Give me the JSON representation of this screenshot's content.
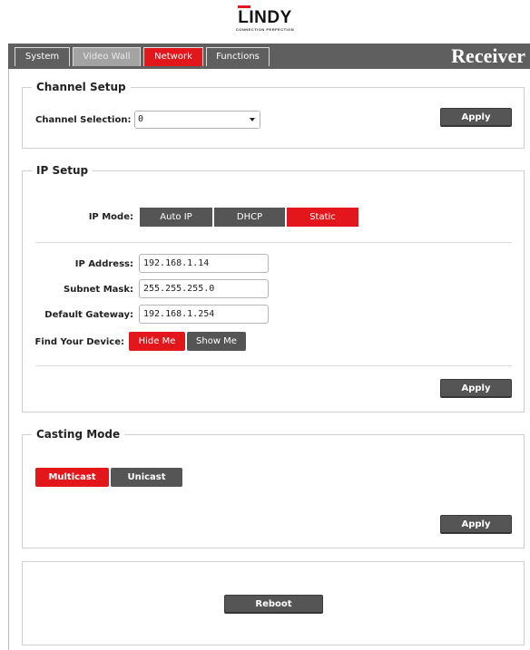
{
  "logo": {
    "brand": "LINDY",
    "tagline": "CONNECTION PERFECTION"
  },
  "tabs": [
    {
      "label": "System"
    },
    {
      "label": "Video Wall"
    },
    {
      "label": "Network"
    },
    {
      "label": "Functions"
    }
  ],
  "page_title": "Receiver",
  "channel_setup": {
    "legend": "Channel Setup",
    "channel_label": "Channel Selection:",
    "channel_value": "0",
    "apply_label": "Apply"
  },
  "ip_setup": {
    "legend": "IP Setup",
    "mode_label": "IP Mode:",
    "modes": [
      {
        "label": "Auto IP",
        "selected": false
      },
      {
        "label": "DHCP",
        "selected": false
      },
      {
        "label": "Static",
        "selected": true
      }
    ],
    "ip_label": "IP Address:",
    "ip_value": "192.168.1.14",
    "mask_label": "Subnet Mask:",
    "mask_value": "255.255.255.0",
    "gateway_label": "Default Gateway:",
    "gateway_value": "192.168.1.254",
    "find_label": "Find Your Device:",
    "hide_label": "Hide Me",
    "show_label": "Show Me",
    "apply_label": "Apply"
  },
  "casting_mode": {
    "legend": "Casting Mode",
    "multicast_label": "Multicast",
    "unicast_label": "Unicast",
    "selected": "Multicast",
    "apply_label": "Apply"
  },
  "reboot": {
    "label": "Reboot"
  },
  "colors": {
    "accent_red": "#e3171b",
    "button_dark": "#555555",
    "tabbar_bg": "#5f5f5f",
    "tab_disabled": "#a3a3a3"
  }
}
